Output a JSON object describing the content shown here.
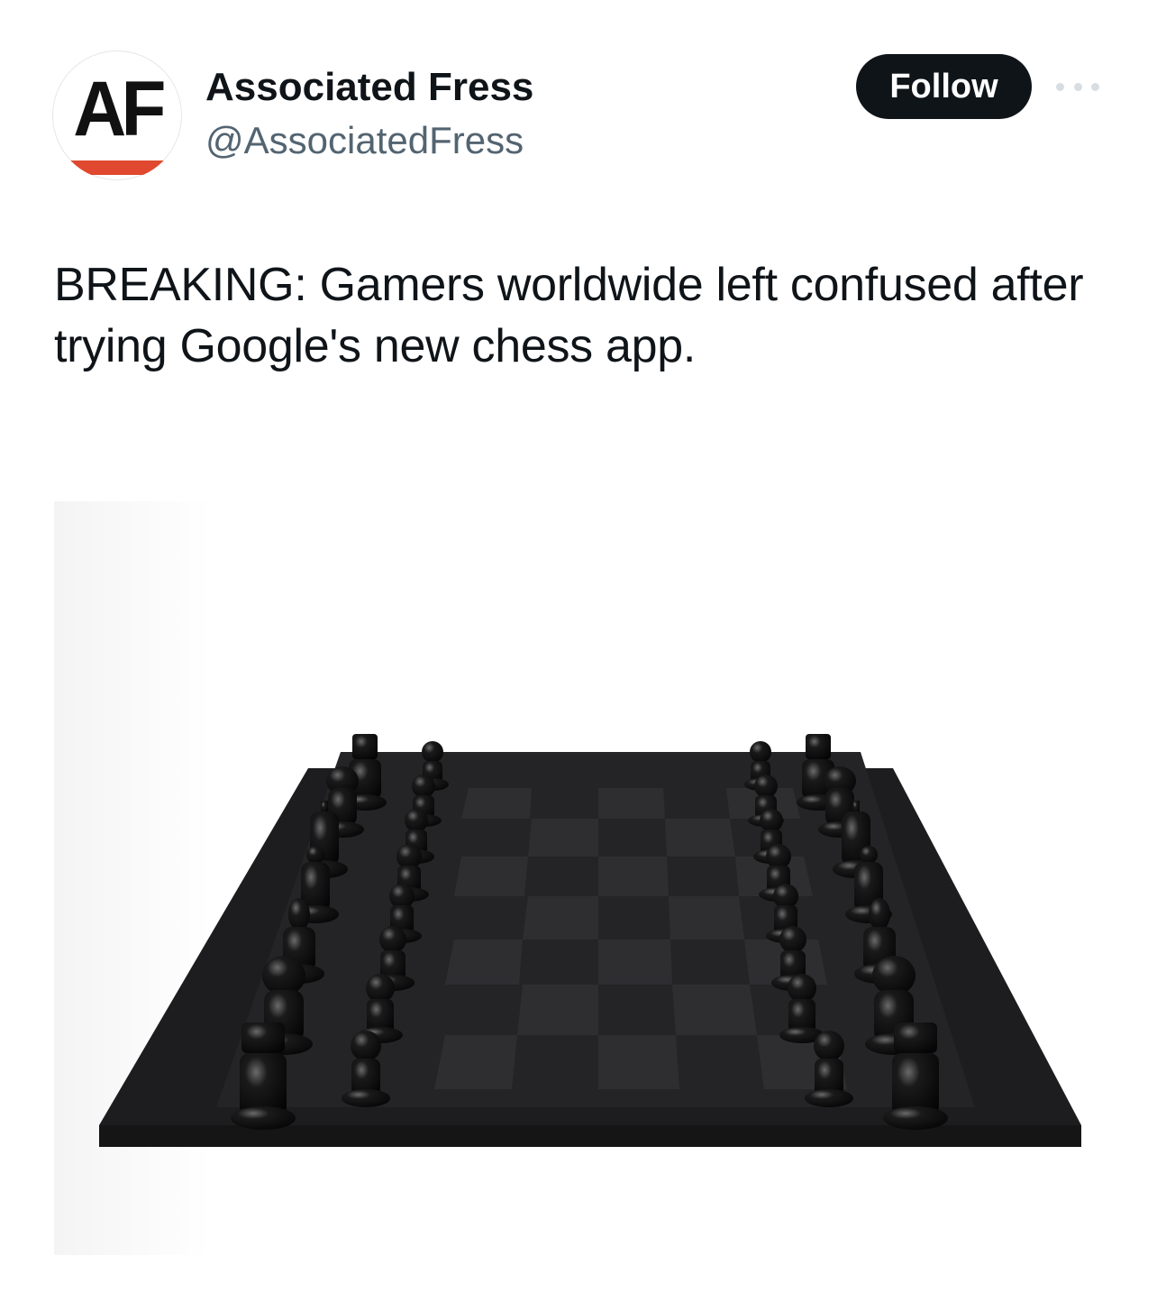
{
  "account": {
    "avatar_letters": "AF",
    "display_name": "Associated Fress",
    "handle": "@AssociatedFress"
  },
  "actions": {
    "follow_label": "Follow",
    "more_icon": "more-horizontal-icon"
  },
  "post": {
    "text": "BREAKING: Gamers worldwide left confused after trying Google's new chess app."
  },
  "media": {
    "description_icon": "chess-board-image"
  },
  "colors": {
    "brand_red": "#e0492f",
    "follow_button": "#0f1419",
    "handle_gray": "#536471"
  }
}
